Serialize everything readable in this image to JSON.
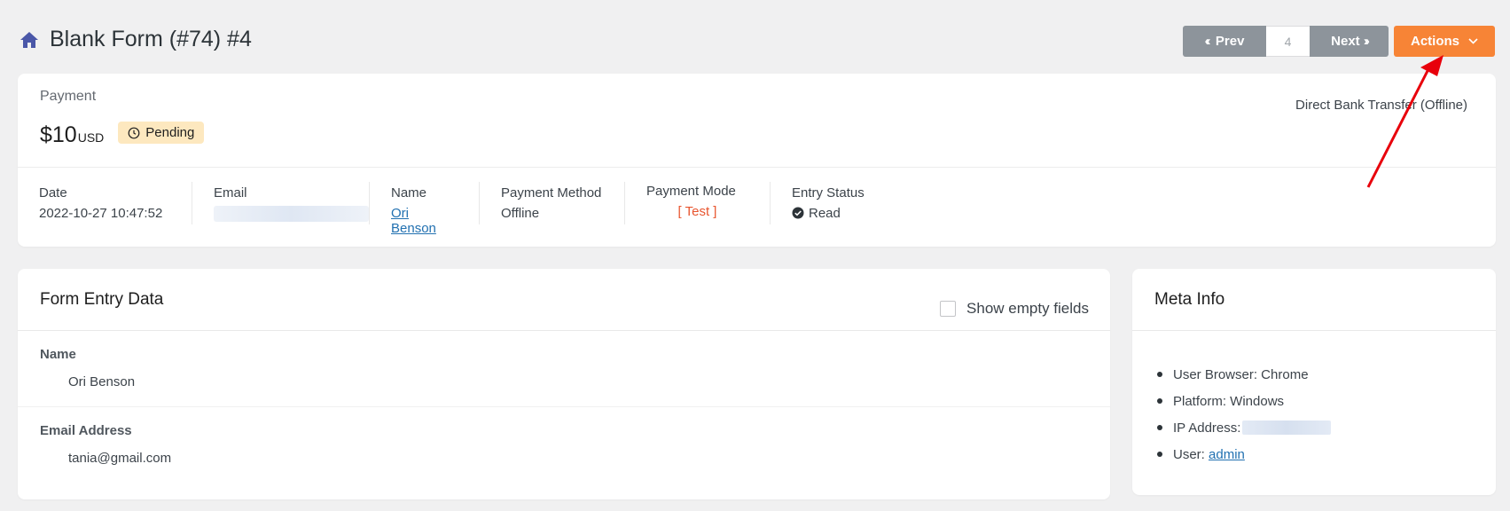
{
  "header": {
    "title": "Blank Form (#74) #4",
    "home_icon": "home-icon"
  },
  "pager": {
    "prev_label": "Prev",
    "page_number": "4",
    "next_label": "Next",
    "actions_label": "Actions"
  },
  "payment": {
    "section_label": "Payment",
    "amount": "$10",
    "currency": "USD",
    "status_badge": "Pending",
    "gateway": "Direct Bank Transfer (Offline)",
    "details": {
      "date_label": "Date",
      "date_value": "2022-10-27 10:47:52",
      "email_label": "Email",
      "name_label": "Name",
      "name_value": "Ori Benson",
      "method_label": "Payment Method",
      "method_value": "Offline",
      "mode_label": "Payment Mode",
      "mode_value": "[ Test ]",
      "entry_status_label": "Entry Status",
      "entry_status_value": "Read"
    }
  },
  "entry": {
    "title": "Form Entry Data",
    "show_empty_label": "Show empty fields",
    "show_empty_checked": false,
    "fields": [
      {
        "label": "Name",
        "value": "Ori Benson"
      },
      {
        "label": "Email Address",
        "value": "tania@gmail.com"
      }
    ]
  },
  "meta": {
    "title": "Meta Info",
    "browser": "User Browser: Chrome",
    "platform": "Platform: Windows",
    "ip_label": "IP Address:",
    "user_label": "User:",
    "user_value": "admin"
  },
  "colors": {
    "accent": "#f78436",
    "gray_button": "#8d949b",
    "pending_bg": "#fde8bf",
    "test_red": "#e8552f",
    "link": "#2271b1",
    "annotation_arrow": "#e8000b"
  }
}
